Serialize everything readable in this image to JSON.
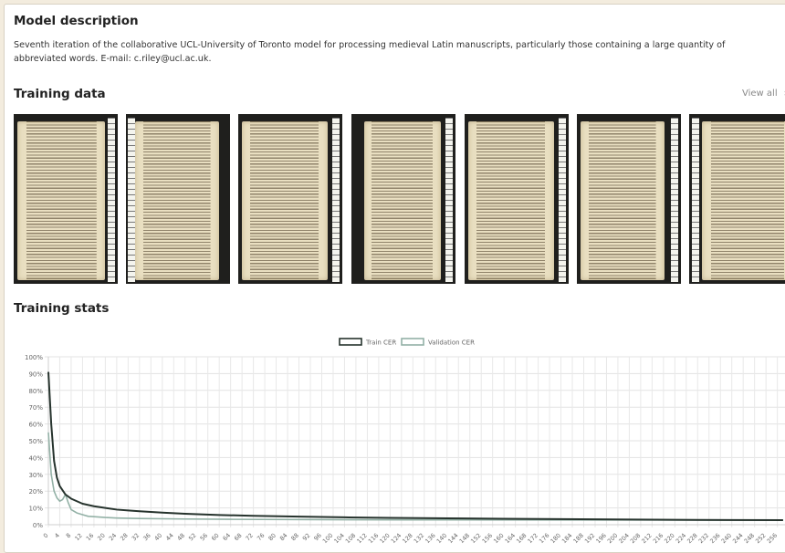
{
  "model_description": {
    "heading": "Model description",
    "text": "Seventh iteration of the collaborative UCL-University of Toronto model for processing medieval Latin manuscripts, particularly those containing a large quantity of abbreviated words. E-mail: c.riley@ucl.ac.uk."
  },
  "training_data": {
    "heading": "Training data",
    "view_all": "View all",
    "view_all_icon": "chevron-right-icon",
    "thumbnail_count": 7
  },
  "training_stats": {
    "heading": "Training stats"
  },
  "colors": {
    "train": "#26332d",
    "validation": "#93b1a6"
  },
  "chart_data": {
    "type": "line",
    "legend": [
      "Train CER",
      "Validation CER"
    ],
    "legend_position": "top-center",
    "grid": true,
    "ylim": [
      0,
      100
    ],
    "y_ticks": [
      "0%",
      "10%",
      "20%",
      "30%",
      "40%",
      "50%",
      "60%",
      "70%",
      "80%",
      "90%",
      "100%"
    ],
    "x_tick_step": 4,
    "x_max": 256,
    "series": [
      {
        "name": "Train CER",
        "points": [
          [
            0,
            91
          ],
          [
            1,
            60
          ],
          [
            2,
            38
          ],
          [
            3,
            28
          ],
          [
            4,
            23
          ],
          [
            6,
            18
          ],
          [
            8,
            15.5
          ],
          [
            10,
            14
          ],
          [
            12,
            12.5
          ],
          [
            16,
            11
          ],
          [
            20,
            10
          ],
          [
            24,
            9
          ],
          [
            28,
            8.5
          ],
          [
            32,
            8
          ],
          [
            40,
            7.2
          ],
          [
            48,
            6.5
          ],
          [
            60,
            5.8
          ],
          [
            72,
            5.3
          ],
          [
            88,
            4.8
          ],
          [
            104,
            4.4
          ],
          [
            120,
            4.1
          ],
          [
            140,
            3.8
          ],
          [
            160,
            3.5
          ],
          [
            180,
            3.3
          ],
          [
            200,
            3.1
          ],
          [
            220,
            2.9
          ],
          [
            240,
            2.8
          ],
          [
            258,
            2.7
          ]
        ]
      },
      {
        "name": "Validation CER",
        "points": [
          [
            0,
            55
          ],
          [
            1,
            30
          ],
          [
            2,
            20
          ],
          [
            3,
            16
          ],
          [
            4,
            14
          ],
          [
            5,
            15
          ],
          [
            6,
            18
          ],
          [
            7,
            13
          ],
          [
            8,
            9
          ],
          [
            10,
            7
          ],
          [
            12,
            6
          ],
          [
            14,
            5
          ],
          [
            16,
            4.8
          ],
          [
            20,
            4.3
          ],
          [
            24,
            4
          ],
          [
            32,
            3.7
          ],
          [
            48,
            3.4
          ],
          [
            64,
            3.2
          ],
          [
            96,
            3
          ],
          [
            128,
            2.9
          ],
          [
            192,
            2.8
          ],
          [
            258,
            2.7
          ]
        ]
      }
    ]
  }
}
